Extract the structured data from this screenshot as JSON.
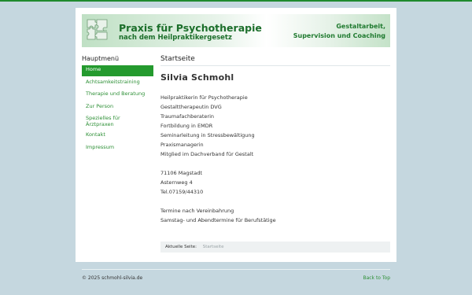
{
  "header": {
    "title": "Praxis für Psychotherapie",
    "subtitle": "nach dem Heilpraktikergesetz",
    "tagline_line1": "Gestaltarbeit,",
    "tagline_line2": "Supervision und Coaching"
  },
  "sidebar": {
    "heading": "Hauptmenü",
    "items": [
      {
        "label": "Home",
        "active": true
      },
      {
        "label": "Achtsamkeitstraining",
        "active": false
      },
      {
        "label": "Therapie und Beratung",
        "active": false
      },
      {
        "label": "Zur Person",
        "active": false
      },
      {
        "label": "Spezielles für Ärztpraxen",
        "active": false
      },
      {
        "label": "Kontakt",
        "active": false
      },
      {
        "label": "Impressum",
        "active": false
      }
    ]
  },
  "main": {
    "section_title": "Startseite",
    "heading": "Silvia Schmohl",
    "qualifications": [
      "Heilpraktikerin für Psychotherapie",
      "Gestalttherapeutin DVG",
      "Traumafachberaterin",
      "Fortbildung in EMDR",
      "Seminarleitung in Stressbewältigung",
      "Praxismanagerin",
      "Mitglied im Dachverband für Gestalt"
    ],
    "address": [
      "71106 Magstadt",
      "Asternweg 4",
      "Tel.07159/44310"
    ],
    "appointments": [
      "Termine nach Vereinbahrung",
      "Samstag- und Abendtermine für Berufstätige"
    ],
    "breadcrumb_label": "Aktuelle Seite:",
    "breadcrumb_value": "Startseite"
  },
  "footer": {
    "copyright": "© 2025 schmohl-silvia.de",
    "back_to_top": "Back to Top"
  },
  "colors": {
    "accent": "#249a2e",
    "link": "#2c8f35",
    "background": "#c5d7df"
  }
}
